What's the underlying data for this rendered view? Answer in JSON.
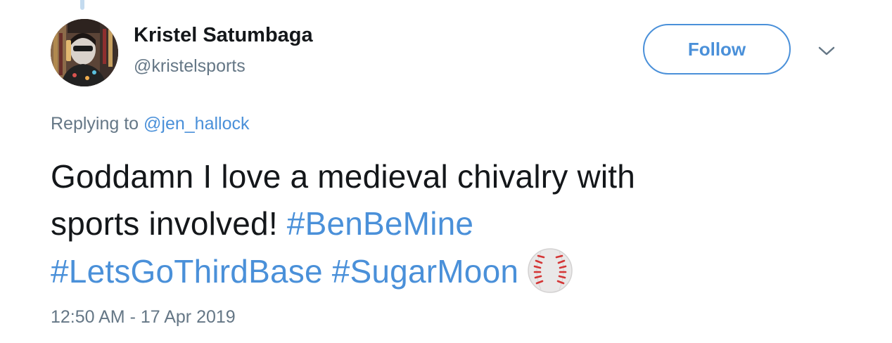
{
  "user": {
    "display_name": "Kristel Satumbaga",
    "handle": "@kristelsports",
    "avatar_icon": "profile-photo"
  },
  "actions": {
    "follow_label": "Follow",
    "more_icon": "chevron-down-icon"
  },
  "reply_context": {
    "prefix": "Replying to",
    "mention": "@jen_hallock"
  },
  "tweet": {
    "line1_text": "Goddamn I love a medieval chivalry with",
    "line2_text": "sports involved!",
    "hashtag1": "#BenBeMine",
    "hashtag2": "#LetsGoThirdBase",
    "hashtag3": "#SugarMoon",
    "emoji": "baseball-icon",
    "timestamp": "12:50 AM - 17 Apr 2019"
  },
  "colors": {
    "link": "#4a90d9",
    "text": "#14171a",
    "secondary": "#657786"
  }
}
